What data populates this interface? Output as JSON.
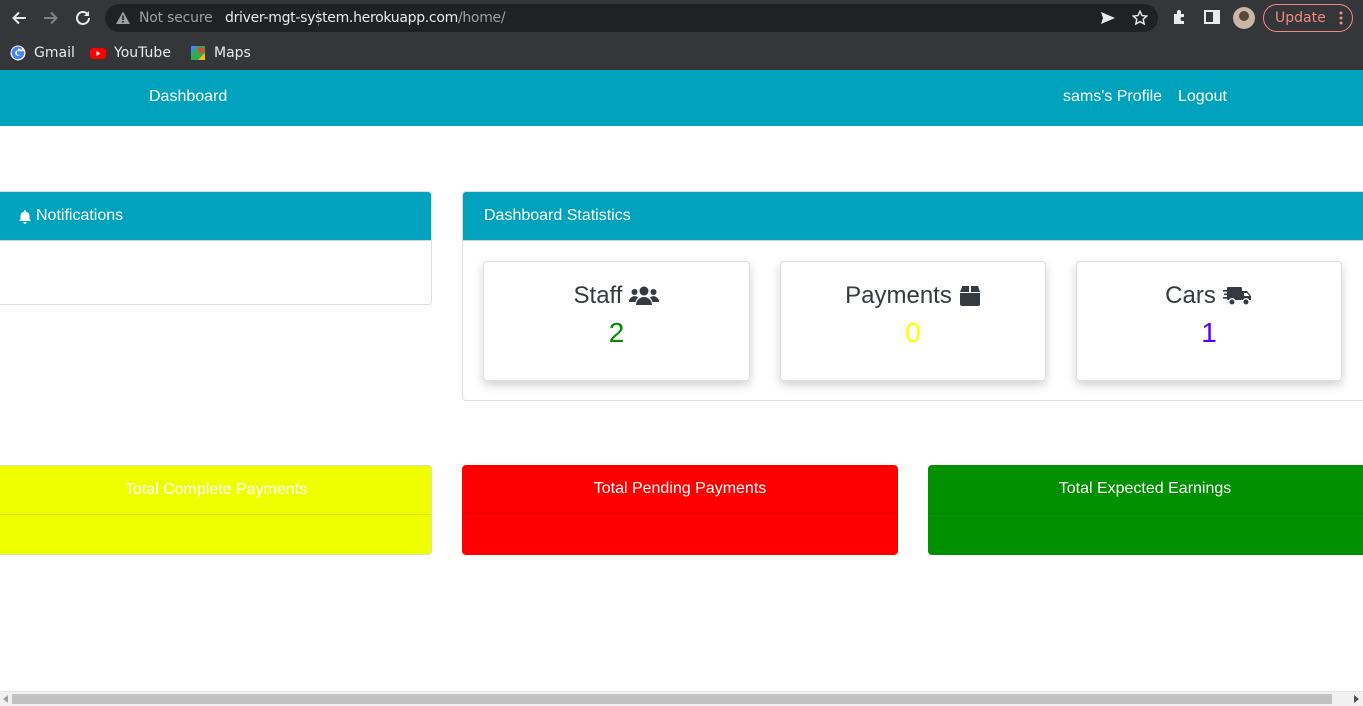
{
  "browser": {
    "not_secure": "Not secure",
    "url_host": "driver-mgt-system.herokuapp.com",
    "url_path": "/home/",
    "update_label": "Update",
    "bookmarks": [
      "Gmail",
      "YouTube",
      "Maps"
    ]
  },
  "navbar": {
    "brand": "Dashboard",
    "profile": "sams's Profile",
    "logout": "Logout"
  },
  "notifications": {
    "title": "Notifications"
  },
  "stats": {
    "title": "Dashboard Statistics",
    "items": [
      {
        "label": "Staff",
        "value": "2",
        "color": "#008f00"
      },
      {
        "label": "Payments",
        "value": "0",
        "color": "#ffff00"
      },
      {
        "label": "Cars",
        "value": "1",
        "color": "#5500ff"
      }
    ]
  },
  "summary": [
    {
      "label": "Total Complete Payments",
      "color": "#f0ff00"
    },
    {
      "label": "Total Pending Payments",
      "color": "#ff0000"
    },
    {
      "label": "Total Expected Earnings",
      "color": "#009000"
    }
  ]
}
